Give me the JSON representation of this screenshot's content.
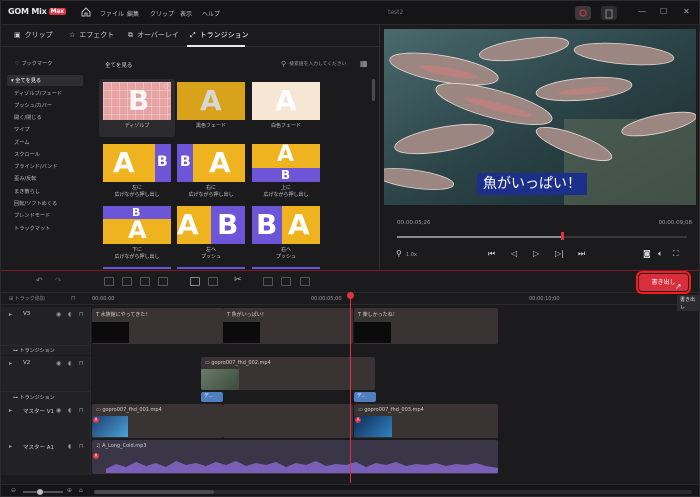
{
  "app": {
    "logo": "GOM Mix",
    "logo_badge": "Max",
    "window_title": "test2"
  },
  "menu": [
    "ファイル",
    "編集",
    "クリップ",
    "表示",
    "ヘルプ"
  ],
  "tabs": [
    {
      "label": "クリップ",
      "icon": "folder-icon"
    },
    {
      "label": "エフェクト",
      "icon": "star-icon"
    },
    {
      "label": "オーバーレイ",
      "icon": "overlay-icon"
    },
    {
      "label": "トランジション",
      "icon": "transition-icon",
      "active": true
    }
  ],
  "sidebar": {
    "bookmark": "ブックマーク",
    "items": [
      "全てを見る",
      "ディゾルブ/フェード",
      "プッシュ/カバー",
      "開く/閉じる",
      "ワイプ",
      "ズーム",
      "スクロール",
      "ブラインド/バンド",
      "歪み/反転",
      "まき散らし",
      "回転/ソフトめくる",
      "ブレンドモード",
      "トラックマット"
    ],
    "selected": 0
  },
  "grid": {
    "header": "全てを見る",
    "search_placeholder": "検索語を入力してください",
    "items": [
      {
        "label": "ディゾルブ",
        "glyph": "B",
        "glyph2": "A"
      },
      {
        "label": "黒色フェード",
        "glyph": "A"
      },
      {
        "label": "白色フェード",
        "glyph": "A"
      },
      {
        "label": "左に\n広げながら押し出し",
        "glyph": "A",
        "glyph2": "B"
      },
      {
        "label": "右に\n広げながら押し出し",
        "glyph": "B",
        "glyph2": "A"
      },
      {
        "label": "上に\n広げながら押し出し",
        "glyph": "A",
        "glyph2": "B"
      },
      {
        "label": "下に\n広げながら押し出し",
        "glyph": "B",
        "glyph2": "A"
      },
      {
        "label": "左へ\nプッシュ",
        "glyph": "A",
        "glyph2": "B"
      },
      {
        "label": "右へ\nプッシュ",
        "glyph": "B",
        "glyph2": "A"
      }
    ]
  },
  "preview": {
    "caption": "魚がいっぱい！",
    "time_current": "00:00:05;26",
    "time_total": "00:00:09;08",
    "zoom": "1.0x",
    "progress": 0.57
  },
  "toolbar": {
    "export_label": "書き出し",
    "export_tooltip": "書き出し"
  },
  "ruler": {
    "labels": [
      "00:00:00",
      "00:00:05;00",
      "00:00:10;00"
    ]
  },
  "timeline": {
    "track_header_label": "トラック追加",
    "tracks": [
      {
        "name": "V3",
        "clips": [
          {
            "label": "水族館にやってきた！"
          },
          {
            "label": "魚がいっぱい！"
          },
          {
            "label": "楽しかったね！"
          }
        ]
      },
      {
        "name": "トランジション",
        "clips": []
      },
      {
        "name": "V2",
        "clips": [
          {
            "label": "gopro007_fhd_002.mp4"
          }
        ]
      },
      {
        "name": "トランジション",
        "clips": [
          {
            "label": "デ..."
          },
          {
            "label": "デ..."
          }
        ]
      },
      {
        "name": "マスター V1",
        "clips": [
          {
            "label": "gopro007_fhd_001.mp4"
          },
          {
            "label": "gopro007_fhd_003.mp4"
          }
        ]
      },
      {
        "name": "マスター A1",
        "clips": [
          {
            "label": "A_Long_Cold.mp3"
          }
        ]
      }
    ]
  },
  "colors": {
    "accent": "#d92e3c",
    "thumb_yellow": "#f0b320",
    "thumb_purple": "#6c55d6",
    "thumb_pink": "#e7a3a3"
  }
}
